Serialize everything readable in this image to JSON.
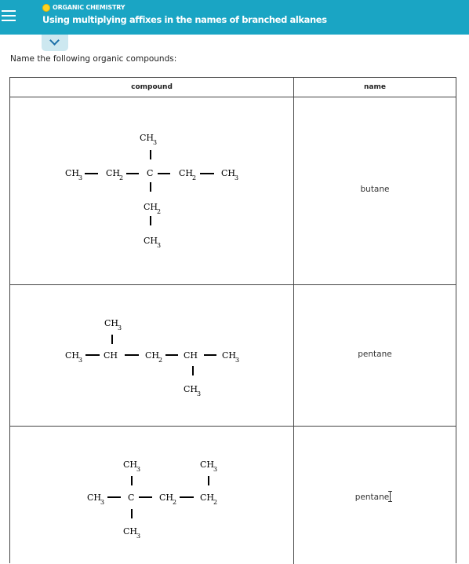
{
  "header": {
    "category": "ORGANIC CHEMISTRY",
    "title": "Using multiplying affixes in the names of branched alkanes"
  },
  "instructions": "Name the following organic compounds:",
  "table": {
    "columns": [
      "compound",
      "name"
    ],
    "rows": [
      {
        "name": "butane"
      },
      {
        "name": "pentane"
      },
      {
        "name": "pentane"
      }
    ]
  },
  "structure_labels": {
    "ch3": "CH",
    "ch3_sub": "3",
    "ch2": "CH",
    "ch2_sub": "2",
    "ch": "CH",
    "c": "C"
  },
  "colors": {
    "header_bg": "#1aa5c4",
    "status_dot": "#ffd21f",
    "tab_bg": "#cde8f0"
  }
}
